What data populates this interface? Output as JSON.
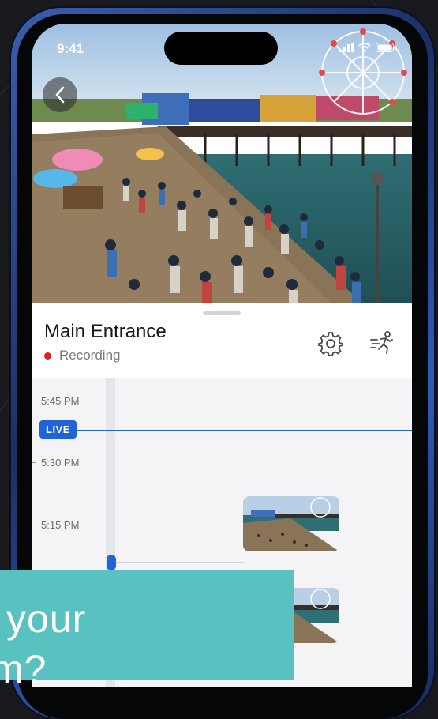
{
  "status_bar": {
    "time": "9:41"
  },
  "camera": {
    "title": "Main Entrance",
    "status": "Recording"
  },
  "timeline": {
    "live_label": "LIVE",
    "times": [
      "5:45 PM",
      "5:30 PM",
      "5:15 PM"
    ]
  },
  "banner": {
    "line1": "your",
    "line2": "m?"
  },
  "colors": {
    "accent": "#1f63d6",
    "recording": "#e0201f",
    "banner": "#59c2c0",
    "frame": "#2e5ab8"
  },
  "icons": [
    "chevron-left-icon",
    "gear-icon",
    "motion-filter-icon",
    "signal-icon",
    "wifi-icon",
    "battery-icon"
  ]
}
